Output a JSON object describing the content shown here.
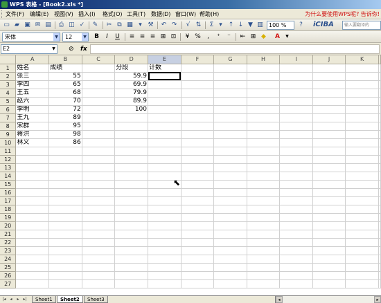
{
  "window": {
    "title": "WPS 表格 - [Book2.xls *]"
  },
  "menubar": {
    "items": [
      "文件(F)",
      "编辑(E)",
      "视图(V)",
      "插入(I)",
      "格式(O)",
      "工具(T)",
      "数据(D)",
      "窗口(W)",
      "帮助(H)"
    ],
    "ad_text": "为什么要使用WPS呢? 告诉你!"
  },
  "toolbar": {
    "zoom": "100 %",
    "ciba_label": "iCIBA",
    "ciba_placeholder": "输入要翻译的"
  },
  "format_toolbar": {
    "font_name": "宋体",
    "font_size": "12",
    "bold_label": "B",
    "italic_label": "I",
    "underline_label": "U"
  },
  "formula_bar": {
    "cell_ref": "E2",
    "fx_label": "fx",
    "formula": ""
  },
  "sheet": {
    "columns": [
      "A",
      "B",
      "C",
      "D",
      "E",
      "F",
      "G",
      "H",
      "I",
      "J",
      "K"
    ],
    "active_cell": "E2",
    "rows": [
      [
        "姓名",
        "成绩",
        "",
        "分段",
        "计数",
        "",
        "",
        "",
        "",
        "",
        ""
      ],
      [
        "张三",
        "55",
        "",
        "59.9",
        "",
        "",
        "",
        "",
        "",
        "",
        ""
      ],
      [
        "李四",
        "65",
        "",
        "69.9",
        "",
        "",
        "",
        "",
        "",
        "",
        ""
      ],
      [
        "王五",
        "68",
        "",
        "79.9",
        "",
        "",
        "",
        "",
        "",
        "",
        ""
      ],
      [
        "赵六",
        "70",
        "",
        "89.9",
        "",
        "",
        "",
        "",
        "",
        "",
        ""
      ],
      [
        "李明",
        "72",
        "",
        "100",
        "",
        "",
        "",
        "",
        "",
        "",
        ""
      ],
      [
        "王九",
        "89",
        "",
        "",
        "",
        "",
        "",
        "",
        "",
        "",
        ""
      ],
      [
        "宋群",
        "95",
        "",
        "",
        "",
        "",
        "",
        "",
        "",
        "",
        ""
      ],
      [
        "蒋洪",
        "98",
        "",
        "",
        "",
        "",
        "",
        "",
        "",
        "",
        ""
      ],
      [
        "林义",
        "86",
        "",
        "",
        "",
        "",
        "",
        "",
        "",
        "",
        ""
      ]
    ],
    "total_rows": 27
  },
  "tabs": {
    "sheets": [
      "Sheet1",
      "Sheet2",
      "Sheet3"
    ],
    "active": "Sheet2"
  },
  "colors": {
    "title_bar": "#0a246a",
    "selection_border": "#000000",
    "header_bg": "#ece9d8"
  }
}
